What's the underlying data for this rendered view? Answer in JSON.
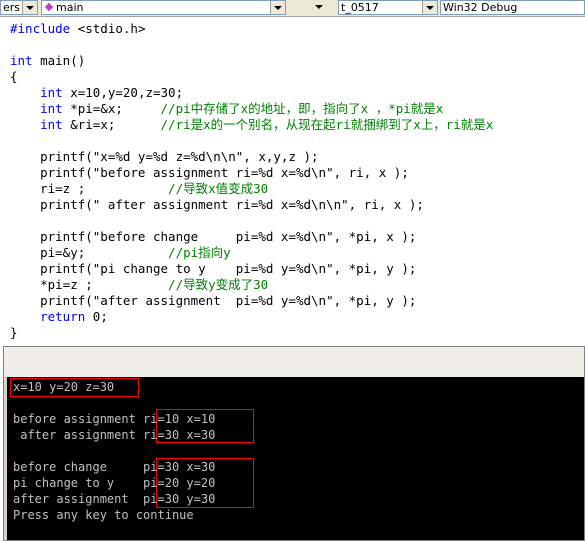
{
  "toolbar": {
    "combo1": "ers",
    "combo2": "main",
    "combo3": "t_0517",
    "combo4": "Win32 Debug"
  },
  "code": [
    [
      "kw:#include ",
      "t:<stdio.h>"
    ],
    [],
    [
      "kw:int ",
      "t:main()"
    ],
    [
      "t:{"
    ],
    [
      "t:    ",
      "kw:int ",
      "t:x=10,y=20,z=30;"
    ],
    [
      "t:    ",
      "kw:int ",
      "t:*pi=&x;     ",
      "cm://pi中存储了x的地址，即，指向了x ，*pi就是x"
    ],
    [
      "t:    ",
      "kw:int ",
      "t:&ri=x;      ",
      "cm://ri是x的一个别名，从现在起ri就捆绑到了x上，ri就是x"
    ],
    [],
    [
      "t:    printf(\"x=%d y=%d z=%d\\n\\n\", x,y,z );"
    ],
    [
      "t:    printf(\"before assignment ri=%d x=%d\\n\", ri, x );"
    ],
    [
      "t:    ri=z ;           ",
      "cm://导致x值变成30"
    ],
    [
      "t:    printf(\" after assignment ri=%d x=%d\\n\\n\", ri, x );"
    ],
    [],
    [
      "t:    printf(\"before change     pi=%d x=%d\\n\", *pi, x );"
    ],
    [
      "t:    pi=&y;           ",
      "cm://pi指向y"
    ],
    [
      "t:    printf(\"pi change to y    pi=%d y=%d\\n\", *pi, y );"
    ],
    [
      "t:    *pi=z ;          ",
      "cm://导致y变成了30"
    ],
    [
      "t:    printf(\"after assignment  pi=%d y=%d\\n\", *pi, y );"
    ],
    [
      "t:    ",
      "kw:return ",
      "t:0;"
    ],
    [
      "t:}"
    ]
  ],
  "console": {
    "lines": [
      "x=10 y=20 z=30",
      "",
      "before assignment ri=10 x=10",
      " after assignment ri=30 x=30",
      "",
      "before change     pi=30 x=30",
      "pi change to y    pi=20 y=20",
      "after assignment  pi=30 y=30",
      "Press any key to continue"
    ]
  },
  "colors": {
    "keyword": "#0000ff",
    "comment": "#008000",
    "console_text": "#c0c0c0",
    "highlight": "#ff0000"
  }
}
